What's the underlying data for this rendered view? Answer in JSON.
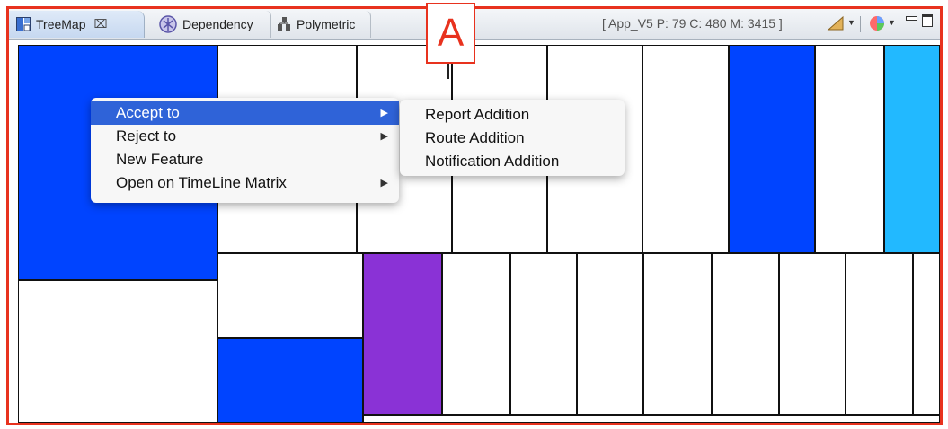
{
  "tabs": [
    {
      "label": "TreeMap",
      "icon": "treemap-icon",
      "close": "⌧",
      "active": true
    },
    {
      "label": "Dependency",
      "icon": "dependency-icon"
    },
    {
      "label": "Polymetric",
      "icon": "polymetric-icon"
    }
  ],
  "status_text": "[ App_V5 P: 79 C: 480 M: 3415 ]",
  "annotation_label": "A",
  "context_menu": {
    "items": [
      {
        "label": "Accept to",
        "has_submenu": true,
        "highlighted": true
      },
      {
        "label": "Reject to",
        "has_submenu": true
      },
      {
        "label": "New Feature",
        "has_submenu": false
      },
      {
        "label": "Open on TimeLine Matrix",
        "has_submenu": true
      }
    ],
    "submenu_arrow": "▶"
  },
  "submenu": {
    "items": [
      "Report Addition",
      "Route Addition",
      "Notification Addition"
    ]
  },
  "colors": {
    "frame_border": "#e8321e",
    "blue": "#0044ff",
    "light_blue": "#22b9ff",
    "purple": "#8a32d6",
    "white": "#ffffff",
    "menu_highlight": "#2f63d8"
  },
  "treemap": {
    "cells": [
      {
        "color": "blue"
      },
      {
        "color": "white"
      },
      {
        "color": "white"
      },
      {
        "color": "white"
      },
      {
        "color": "white"
      },
      {
        "color": "white"
      },
      {
        "color": "blue"
      },
      {
        "color": "white"
      },
      {
        "color": "light_blue"
      },
      {
        "color": "white"
      },
      {
        "color": "white"
      },
      {
        "color": "blue"
      },
      {
        "color": "purple"
      },
      {
        "color": "white"
      },
      {
        "color": "white"
      },
      {
        "color": "white"
      },
      {
        "color": "white"
      },
      {
        "color": "white"
      },
      {
        "color": "white"
      },
      {
        "color": "white"
      },
      {
        "color": "white"
      },
      {
        "color": "white"
      },
      {
        "color": "white"
      }
    ]
  }
}
